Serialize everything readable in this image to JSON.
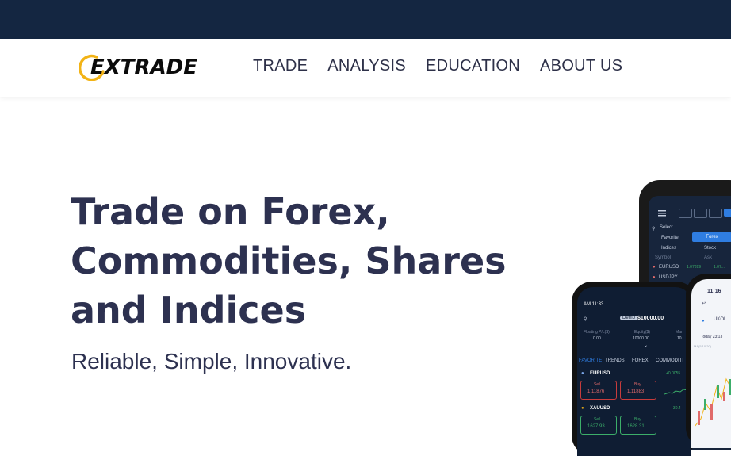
{
  "nav": {
    "logo_text": "EXTRADE",
    "items": [
      "TRADE",
      "ANALYSIS",
      "EDUCATION",
      "ABOUT US"
    ]
  },
  "hero": {
    "title_line1": "Trade on Forex,",
    "title_line2": "Commodities, Shares",
    "title_line3": "and Indices",
    "subtitle": "Reliable, Simple, Innovative."
  },
  "tablet": {
    "select_label": "Select",
    "tab_favorite": "Favorite",
    "tab_forex": "Forex",
    "tab_indices": "Indices",
    "tab_stock": "Stock",
    "col_symbol": "Symbol",
    "col_ask": "Ask",
    "row1_symbol": "EURUSD",
    "row1_val1": "1.07899",
    "row1_val2": "1.07...",
    "row2_symbol": "USDJPY"
  },
  "phone_left": {
    "time": "AM 11:33",
    "demo_badge": "Demo",
    "balance": "$10000.00",
    "floating_label": "Floating P/L($)",
    "floating_val": "0.00",
    "equity_label": "Equity($)",
    "equity_val": "10000.00",
    "margin_label": "Mar",
    "margin_val": "10",
    "tabs": [
      "FAVORITE",
      "TRENDS",
      "FOREX",
      "COMMODITI"
    ],
    "inst1_name": "EURUSD",
    "inst1_change": "+0.0055",
    "inst1_sell_label": "Sell",
    "inst1_sell": "1.11876",
    "inst1_buy_label": "Buy",
    "inst1_buy": "1.11883",
    "inst2_name": "XAUUSD",
    "inst2_change": "+30.4",
    "inst2_sell_label": "Sell",
    "inst2_sell": "1627.93",
    "inst2_buy_label": "Buy",
    "inst2_buy": "1628.31"
  },
  "phone_right": {
    "time": "11:16",
    "symbol": "UKOI",
    "date_text": "Today 23:13",
    "chart_label": "MA(5,10,20)"
  },
  "colors": {
    "topbar": "#142641",
    "heading": "#2d3150",
    "accent_yellow": "#f2b316",
    "accent_blue": "#2f7de1"
  }
}
